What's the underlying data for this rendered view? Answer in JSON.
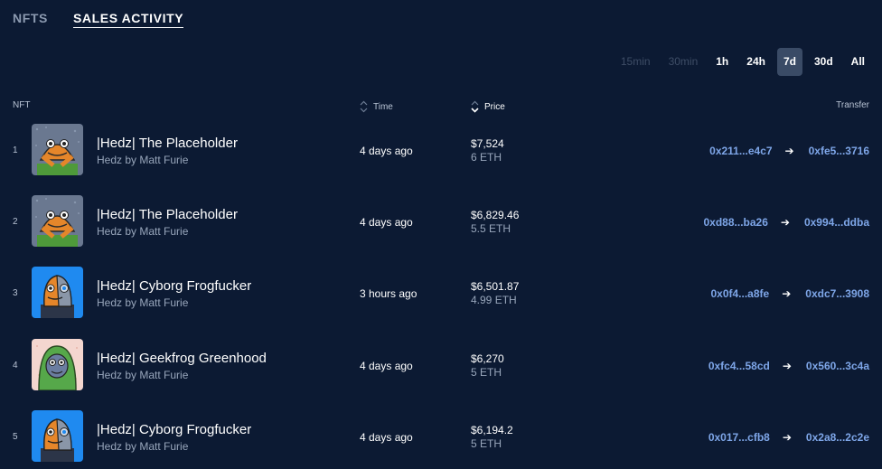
{
  "tabs": [
    {
      "label": "NFTS",
      "active": false
    },
    {
      "label": "SALES ACTIVITY",
      "active": true
    }
  ],
  "timeframes": [
    {
      "label": "15min",
      "state": "disabled"
    },
    {
      "label": "30min",
      "state": "disabled"
    },
    {
      "label": "1h",
      "state": "normal"
    },
    {
      "label": "24h",
      "state": "normal"
    },
    {
      "label": "7d",
      "state": "active"
    },
    {
      "label": "30d",
      "state": "normal"
    },
    {
      "label": "All",
      "state": "normal"
    }
  ],
  "columns": {
    "nft": "NFT",
    "time": "Time",
    "price": "Price",
    "transfer": "Transfer"
  },
  "colors": {
    "background": "#0c1a33",
    "address": "#7ea6e8",
    "active_timeframe": "#3a4b66"
  },
  "rows": [
    {
      "rank": "1",
      "art": "placeholder",
      "name": "|Hedz| The Placeholder",
      "collection": "Hedz by Matt Furie",
      "time": "4 days ago",
      "price_usd": "$7,524",
      "price_eth": "6 ETH",
      "from": "0x211...e4c7",
      "to": "0xfe5...3716"
    },
    {
      "rank": "2",
      "art": "placeholder",
      "name": "|Hedz| The Placeholder",
      "collection": "Hedz by Matt Furie",
      "time": "4 days ago",
      "price_usd": "$6,829.46",
      "price_eth": "5.5 ETH",
      "from": "0xd88...ba26",
      "to": "0x994...ddba"
    },
    {
      "rank": "3",
      "art": "cyborg",
      "name": "|Hedz| Cyborg Frogfucker",
      "collection": "Hedz by Matt Furie",
      "time": "3 hours ago",
      "price_usd": "$6,501.87",
      "price_eth": "4.99 ETH",
      "from": "0x0f4...a8fe",
      "to": "0xdc7...3908"
    },
    {
      "rank": "4",
      "art": "geekfrog",
      "name": "|Hedz| Geekfrog Greenhood",
      "collection": "Hedz by Matt Furie",
      "time": "4 days ago",
      "price_usd": "$6,270",
      "price_eth": "5 ETH",
      "from": "0xfc4...58cd",
      "to": "0x560...3c4a"
    },
    {
      "rank": "5",
      "art": "cyborg",
      "name": "|Hedz| Cyborg Frogfucker",
      "collection": "Hedz by Matt Furie",
      "time": "4 days ago",
      "price_usd": "$6,194.2",
      "price_eth": "5 ETH",
      "from": "0x017...cfb8",
      "to": "0x2a8...2c2e"
    }
  ]
}
